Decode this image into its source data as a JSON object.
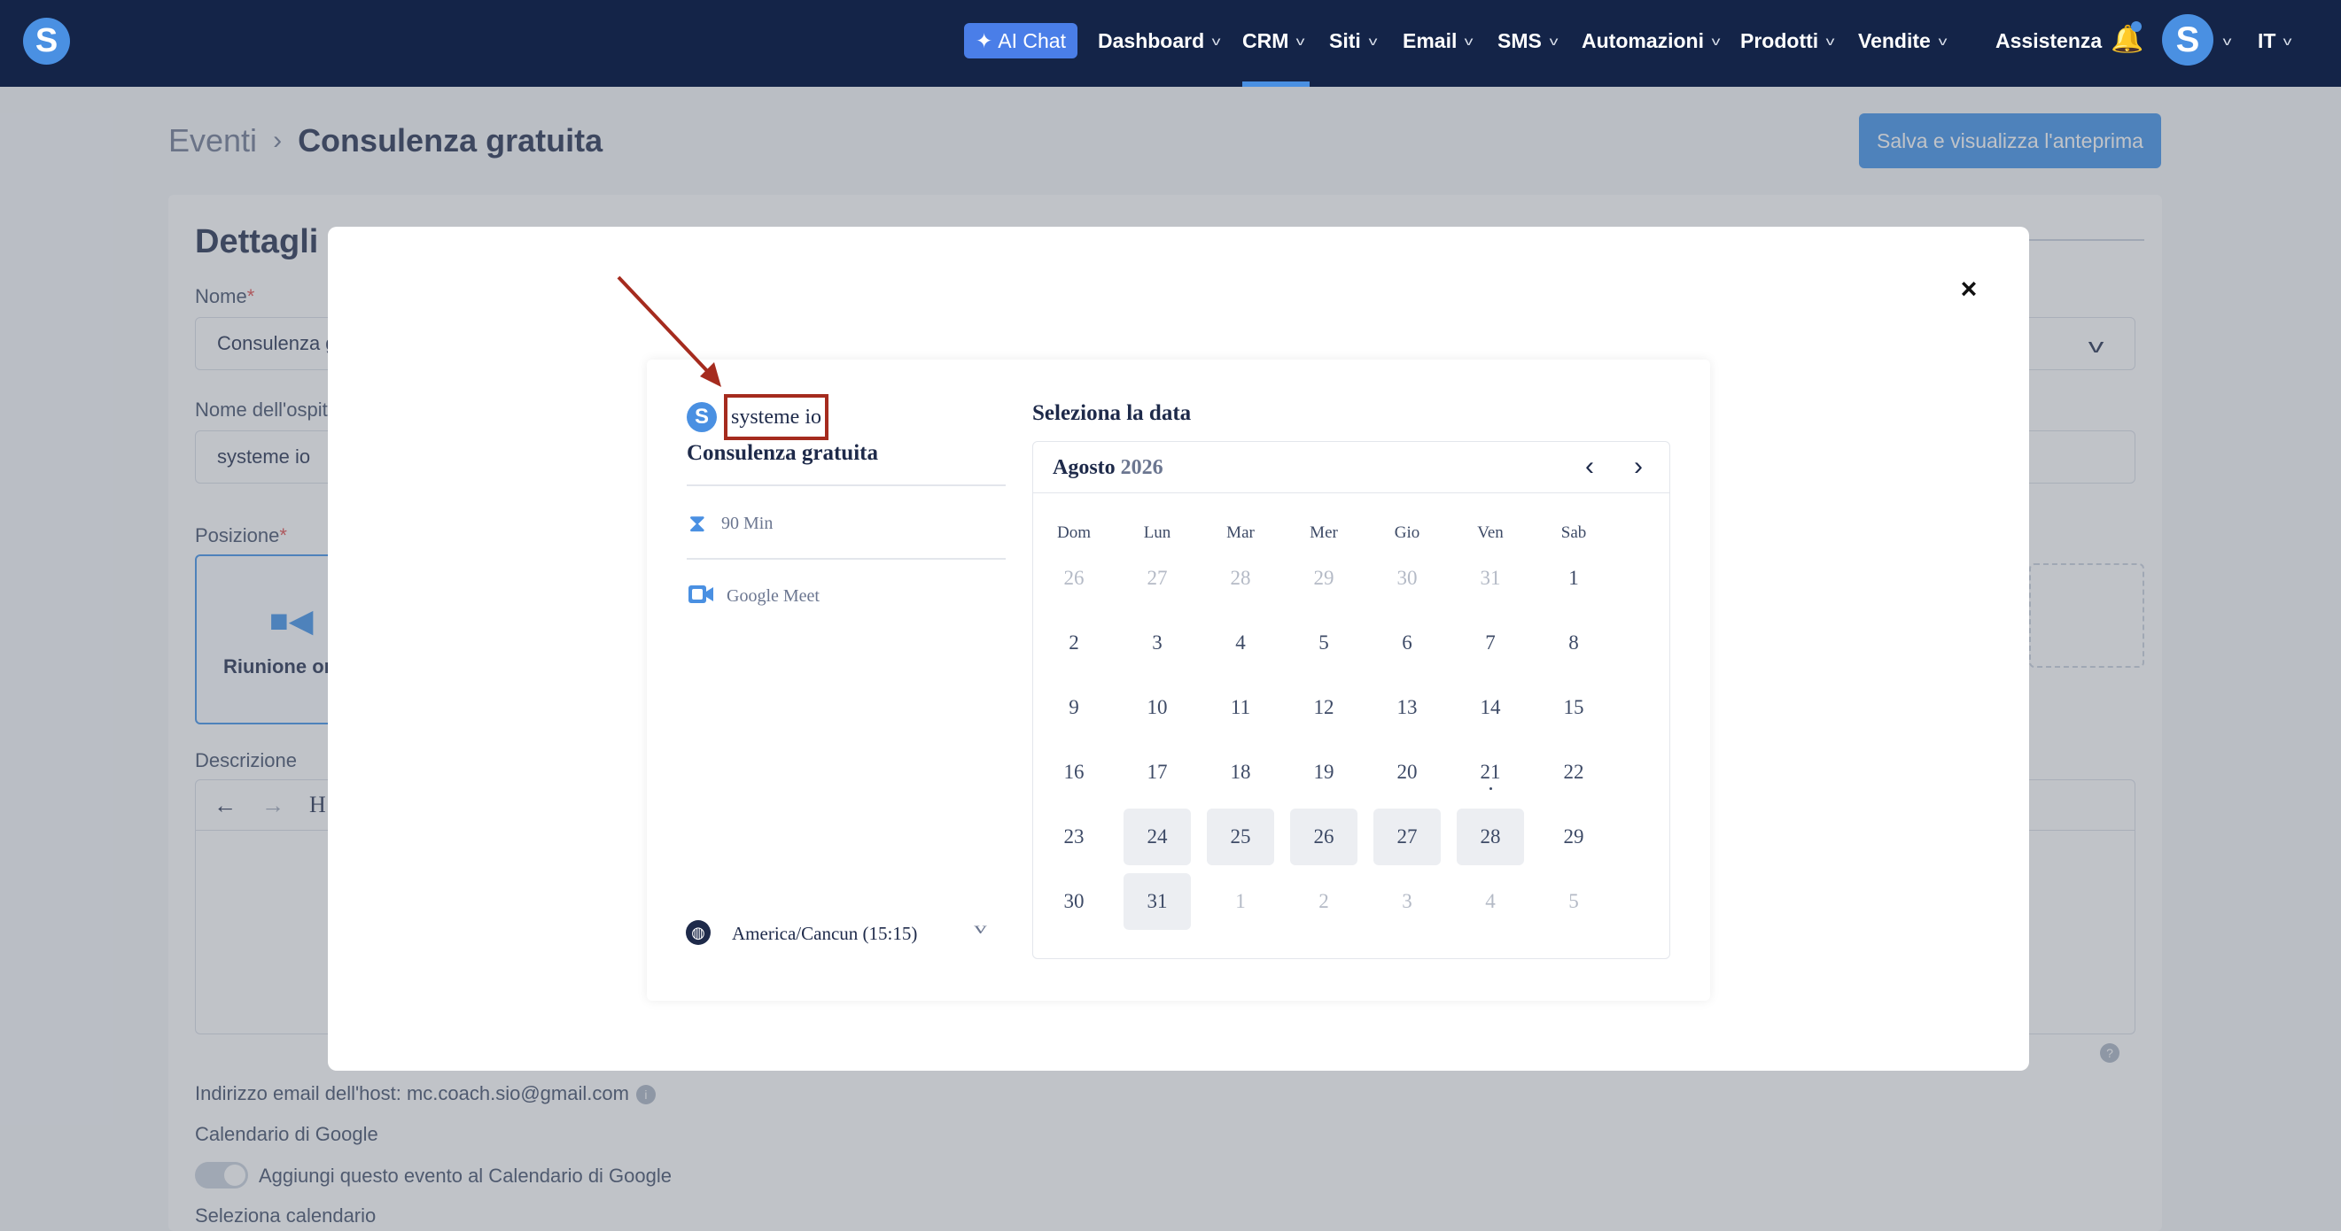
{
  "nav": {
    "ai_chat": "AI Chat",
    "items": [
      "Dashboard",
      "CRM",
      "Siti",
      "Email",
      "SMS",
      "Automazioni",
      "Prodotti",
      "Vendite"
    ],
    "assistenza": "Assistenza",
    "language": "IT",
    "logo_letter": "S",
    "avatar_letter": "S"
  },
  "page": {
    "breadcrumb_parent": "Eventi",
    "breadcrumb_current": "Consulenza gratuita",
    "save_preview_label": "Salva e visualizza l'anteprima",
    "section_title": "Dettagli d",
    "name_label": "Nome",
    "name_value": "Consulenza g",
    "host_label": "Nome dell'ospit",
    "host_value": "systeme io",
    "position_label": "Posizione",
    "position_option": "Riunione on",
    "description_label": "Descrizione",
    "host_email": "Indirizzo email dell'host: mc.coach.sio@gmail.com",
    "google_calendar_label": "Calendario di Google",
    "google_calendar_toggle": "Aggiungi questo evento al Calendario di Google",
    "select_calendar_label": "Seleziona calendario",
    "editor_heading_glyph": "H"
  },
  "modal": {
    "close": "×",
    "host_name": "systeme io",
    "event_name": "Consulenza gratuita",
    "duration": "90 Min",
    "location": "Google Meet",
    "timezone": "America/Cancun (15:15)",
    "select_date_title": "Seleziona la data",
    "calendar": {
      "month": "Agosto",
      "year": "2026",
      "weekdays": [
        "Dom",
        "Lun",
        "Mar",
        "Mer",
        "Gio",
        "Ven",
        "Sab"
      ],
      "weeks": [
        [
          {
            "d": "26",
            "s": "muted"
          },
          {
            "d": "27",
            "s": "muted"
          },
          {
            "d": "28",
            "s": "muted"
          },
          {
            "d": "29",
            "s": "muted"
          },
          {
            "d": "30",
            "s": "muted"
          },
          {
            "d": "31",
            "s": "muted"
          },
          {
            "d": "1",
            "s": ""
          }
        ],
        [
          {
            "d": "2",
            "s": ""
          },
          {
            "d": "3",
            "s": ""
          },
          {
            "d": "4",
            "s": ""
          },
          {
            "d": "5",
            "s": ""
          },
          {
            "d": "6",
            "s": ""
          },
          {
            "d": "7",
            "s": ""
          },
          {
            "d": "8",
            "s": ""
          }
        ],
        [
          {
            "d": "9",
            "s": ""
          },
          {
            "d": "10",
            "s": ""
          },
          {
            "d": "11",
            "s": ""
          },
          {
            "d": "12",
            "s": ""
          },
          {
            "d": "13",
            "s": ""
          },
          {
            "d": "14",
            "s": ""
          },
          {
            "d": "15",
            "s": ""
          }
        ],
        [
          {
            "d": "16",
            "s": ""
          },
          {
            "d": "17",
            "s": ""
          },
          {
            "d": "18",
            "s": ""
          },
          {
            "d": "19",
            "s": ""
          },
          {
            "d": "20",
            "s": ""
          },
          {
            "d": "21",
            "s": "today"
          },
          {
            "d": "22",
            "s": ""
          }
        ],
        [
          {
            "d": "23",
            "s": ""
          },
          {
            "d": "24",
            "s": "avail"
          },
          {
            "d": "25",
            "s": "avail"
          },
          {
            "d": "26",
            "s": "avail"
          },
          {
            "d": "27",
            "s": "avail"
          },
          {
            "d": "28",
            "s": "avail"
          },
          {
            "d": "29",
            "s": ""
          }
        ],
        [
          {
            "d": "30",
            "s": ""
          },
          {
            "d": "31",
            "s": "avail"
          },
          {
            "d": "1",
            "s": "muted"
          },
          {
            "d": "2",
            "s": "muted"
          },
          {
            "d": "3",
            "s": "muted"
          },
          {
            "d": "4",
            "s": "muted"
          },
          {
            "d": "5",
            "s": "muted"
          }
        ]
      ]
    }
  },
  "colors": {
    "nav_bg": "#142448",
    "accent": "#4a90e2",
    "annotation_red": "#a52b1e"
  }
}
